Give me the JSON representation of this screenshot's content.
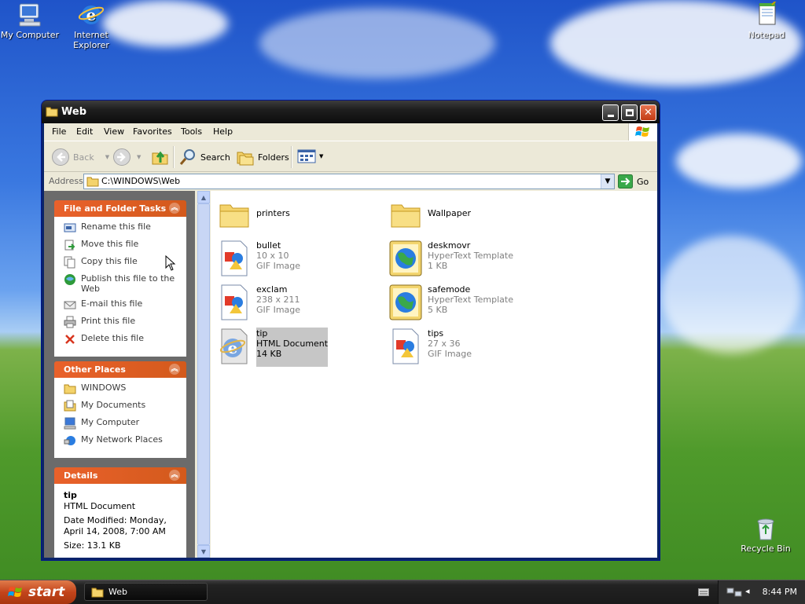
{
  "desktop": {
    "icons": [
      {
        "label": "My Computer",
        "icon": "my-computer-icon"
      },
      {
        "label": "Internet Explorer",
        "icon": "internet-explorer-icon"
      },
      {
        "label": "Notepad",
        "icon": "notepad-icon"
      },
      {
        "label": "Recycle Bin",
        "icon": "recycle-bin-icon"
      }
    ]
  },
  "window": {
    "title": "Web",
    "menu": [
      "File",
      "Edit",
      "View",
      "Favorites",
      "Tools",
      "Help"
    ],
    "toolbar": {
      "back": "Back",
      "search": "Search",
      "folders": "Folders"
    },
    "address": {
      "label": "Address",
      "value": "C:\\WINDOWS\\Web",
      "go": "Go"
    },
    "taskpane": {
      "file_tasks": {
        "title": "File and Folder Tasks",
        "items": [
          {
            "label": "Rename this file",
            "icon": "rename-icon"
          },
          {
            "label": "Move this file",
            "icon": "move-icon"
          },
          {
            "label": "Copy this file",
            "icon": "copy-icon"
          },
          {
            "label": "Publish this file to the Web",
            "icon": "publish-icon"
          },
          {
            "label": "E-mail this file",
            "icon": "email-icon"
          },
          {
            "label": "Print this file",
            "icon": "print-icon"
          },
          {
            "label": "Delete this file",
            "icon": "delete-icon"
          }
        ]
      },
      "other_places": {
        "title": "Other Places",
        "items": [
          {
            "label": "WINDOWS",
            "icon": "folder-icon"
          },
          {
            "label": "My Documents",
            "icon": "my-documents-icon"
          },
          {
            "label": "My Computer",
            "icon": "my-computer-icon"
          },
          {
            "label": "My Network Places",
            "icon": "network-places-icon"
          }
        ]
      },
      "details": {
        "title": "Details",
        "name": "tip",
        "type": "HTML Document",
        "modified": "Date Modified: Monday, April 14, 2008, 7:00 AM",
        "size": "Size: 13.1 KB"
      }
    },
    "files": [
      {
        "name": "printers",
        "sub1": "",
        "sub2": "",
        "icon": "folder-icon"
      },
      {
        "name": "Wallpaper",
        "sub1": "",
        "sub2": "",
        "icon": "folder-icon"
      },
      {
        "name": "bullet",
        "sub1": "10 x 10",
        "sub2": "GIF Image",
        "icon": "gif-image-icon"
      },
      {
        "name": "deskmovr",
        "sub1": "HyperText Template",
        "sub2": "1 KB",
        "icon": "hypertext-template-icon"
      },
      {
        "name": "exclam",
        "sub1": "238 x 211",
        "sub2": "GIF Image",
        "icon": "gif-image-icon"
      },
      {
        "name": "safemode",
        "sub1": "HyperText Template",
        "sub2": "5 KB",
        "icon": "hypertext-template-icon"
      },
      {
        "name": "tip",
        "sub1": "HTML Document",
        "sub2": "14 KB",
        "icon": "html-document-icon"
      },
      {
        "name": "tips",
        "sub1": "27 x 36",
        "sub2": "GIF Image",
        "icon": "gif-image-icon"
      }
    ]
  },
  "taskbar": {
    "start": "start",
    "task": "Web",
    "clock": "8:44 PM"
  }
}
